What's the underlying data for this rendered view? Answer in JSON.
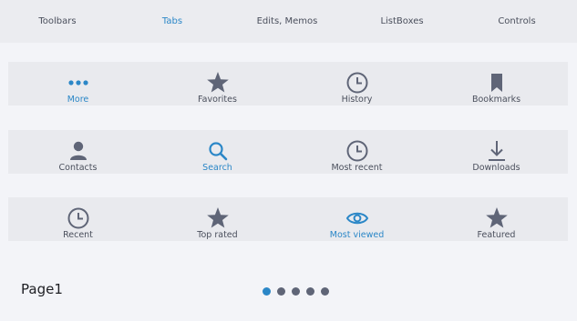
{
  "top_tabs": [
    {
      "label": "Toolbars",
      "active": false
    },
    {
      "label": "Tabs",
      "active": true
    },
    {
      "label": "Edits, Memos",
      "active": false
    },
    {
      "label": "ListBoxes",
      "active": false
    },
    {
      "label": "Controls",
      "active": false
    }
  ],
  "rows": [
    {
      "items": [
        {
          "label": "More",
          "icon": "more-dots-icon",
          "active": true
        },
        {
          "label": "Favorites",
          "icon": "star-icon",
          "active": false
        },
        {
          "label": "History",
          "icon": "clock-icon",
          "active": false
        },
        {
          "label": "Bookmarks",
          "icon": "bookmark-icon",
          "active": false
        }
      ]
    },
    {
      "items": [
        {
          "label": "Contacts",
          "icon": "person-icon",
          "active": false
        },
        {
          "label": "Search",
          "icon": "search-icon",
          "active": true
        },
        {
          "label": "Most recent",
          "icon": "clock-icon",
          "active": false
        },
        {
          "label": "Downloads",
          "icon": "download-icon",
          "active": false
        }
      ]
    },
    {
      "items": [
        {
          "label": "Recent",
          "icon": "clock-icon",
          "active": false
        },
        {
          "label": "Top rated",
          "icon": "star-icon",
          "active": false
        },
        {
          "label": "Most viewed",
          "icon": "eye-icon",
          "active": true
        },
        {
          "label": "Featured",
          "icon": "star-icon",
          "active": false
        }
      ]
    }
  ],
  "pager": {
    "page_label": "Page1",
    "page_count": 5,
    "current_index": 0
  },
  "colors": {
    "accent": "#2b87c7",
    "icon": "#5f6577",
    "text": "#4a4f5c",
    "background": "#f3f4f8",
    "tab_bar": "#e9eaee"
  }
}
